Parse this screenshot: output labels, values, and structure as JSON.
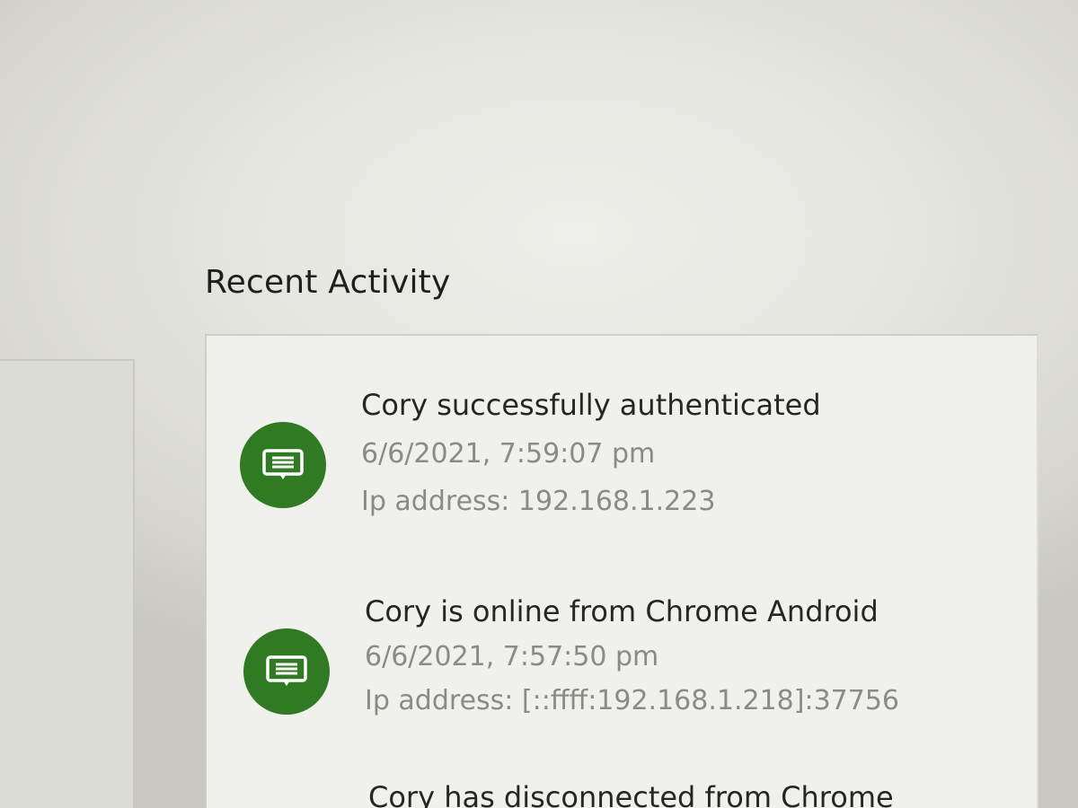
{
  "section": {
    "title": "Recent Activity"
  },
  "activity": {
    "items": [
      {
        "icon": "message-icon",
        "title": "Cory successfully authenticated",
        "timestamp": "6/6/2021, 7:59:07 pm",
        "ip": "Ip address: 192.168.1.223"
      },
      {
        "icon": "message-icon",
        "title": "Cory is online from Chrome Android",
        "timestamp": "6/6/2021, 7:57:50 pm",
        "ip": "Ip address: [::ffff:192.168.1.218]:37756"
      },
      {
        "title": "Cory has disconnected from Chrome"
      }
    ]
  },
  "colors": {
    "icon_bg": "#2f7a22",
    "title_text": "#262626",
    "meta_text": "#8a8a86",
    "card_bg": "#f0f0ec"
  }
}
